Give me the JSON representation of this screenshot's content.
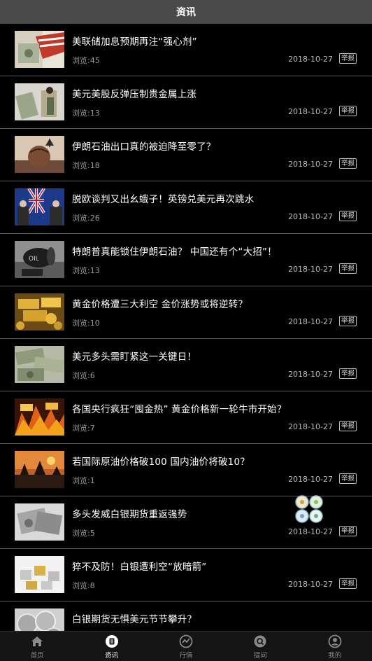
{
  "header": {
    "title": "资讯"
  },
  "news": [
    {
      "title": "美联储加息预期再注“强心剂”",
      "views": "浏览:45",
      "date": "2018-10-27",
      "report": "举报",
      "thumb": "money"
    },
    {
      "title": "美元美股反弹压制贵金属上涨",
      "views": "浏览:13",
      "date": "2018-10-27",
      "report": "举报",
      "thumb": "dollar-hand"
    },
    {
      "title": "伊朗石油出口真的被迫降至零了？",
      "views": "浏览:18",
      "date": "2018-10-27",
      "report": "举报",
      "thumb": "oil-globe"
    },
    {
      "title": "脱欧谈判又出幺蛾子！英镑兑美元再次跳水",
      "views": "浏览:26",
      "date": "2018-10-27",
      "report": "举报",
      "thumb": "flags"
    },
    {
      "title": "特朗普真能锁住伊朗石油？ 中国还有个“大招”！",
      "views": "浏览:13",
      "date": "2018-10-27",
      "report": "举报",
      "thumb": "oil-barrel"
    },
    {
      "title": "黄金价格遭三大利空 金价涨势或将逆转？",
      "views": "浏览:10",
      "date": "2018-10-27",
      "report": "举报",
      "thumb": "gold-bars"
    },
    {
      "title": "美元多头需盯紧这一关键日！",
      "views": "浏览:6",
      "date": "2018-10-27",
      "report": "举报",
      "thumb": "dollar-bills"
    },
    {
      "title": "各国央行疯狂“囤金热” 黄金价格新一轮牛市开始？",
      "views": "浏览:7",
      "date": "2018-10-27",
      "report": "举报",
      "thumb": "gold-fire"
    },
    {
      "title": "若国际原油价格破100 国内油价将破10？",
      "views": "浏览:1",
      "date": "2018-10-27",
      "report": "举报",
      "thumb": "oil-field"
    },
    {
      "title": "多头发威白银期货重返强势",
      "views": "浏览:5",
      "date": "2018-10-27",
      "report": "举报",
      "thumb": "silver"
    },
    {
      "title": "猝不及防！白银遭利空“放暗箭”",
      "views": "浏览:8",
      "date": "2018-10-27",
      "report": "举报",
      "thumb": "silver-bars"
    },
    {
      "title": "白银期货无惧美元节节攀升？",
      "views": "",
      "date": "",
      "report": "",
      "thumb": "silver-coins"
    }
  ],
  "tabs": [
    {
      "label": "首页",
      "icon": "home-icon",
      "active": false
    },
    {
      "label": "资讯",
      "icon": "news-icon",
      "active": true
    },
    {
      "label": "行情",
      "icon": "chart-icon",
      "active": false
    },
    {
      "label": "提问",
      "icon": "question-icon",
      "active": false
    },
    {
      "label": "我的",
      "icon": "profile-icon",
      "active": false
    }
  ]
}
